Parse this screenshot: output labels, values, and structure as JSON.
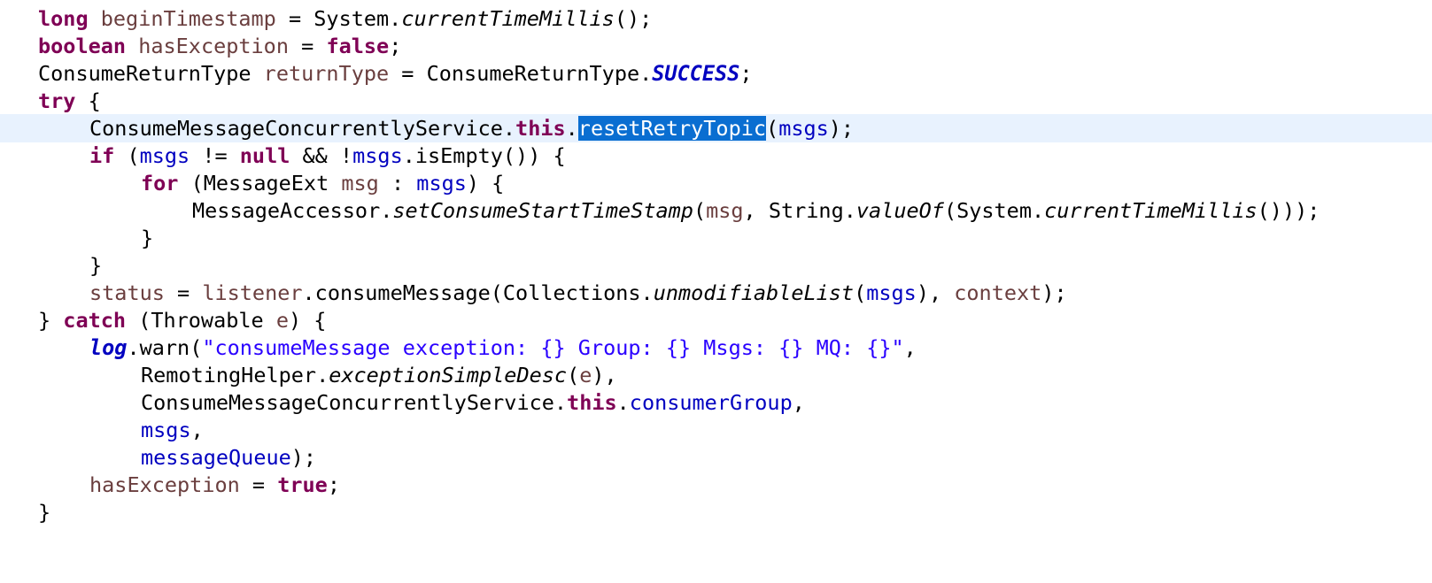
{
  "editor": {
    "selected_token": "resetRetryTopic",
    "lines": [
      [
        "long",
        " ",
        "beginTimestamp",
        " = System.",
        "currentTimeMillis",
        "();"
      ],
      [
        "boolean",
        " ",
        "hasException",
        " = ",
        "false",
        ";"
      ],
      [
        "ConsumeReturnType ",
        "returnType",
        " = ConsumeReturnType.",
        "SUCCESS",
        ";"
      ],
      [
        "try",
        " {"
      ],
      [
        "ConsumeMessageConcurrentlyService.",
        "this",
        ".",
        "resetRetryTopic",
        "(",
        "msgs",
        ");"
      ],
      [
        "if",
        " (",
        "msgs",
        " != ",
        "null",
        " && !",
        "msgs",
        ".isEmpty()) {"
      ],
      [
        "for",
        " (MessageExt ",
        "msg",
        " : ",
        "msgs",
        ") {"
      ],
      [
        "MessageAccessor.",
        "setConsumeStartTimeStamp",
        "(",
        "msg",
        ", String.",
        "valueOf",
        "(System.",
        "currentTimeMillis",
        "()));"
      ],
      [
        "}"
      ],
      [
        "}"
      ],
      [
        "status",
        " = ",
        "listener",
        ".consumeMessage(Collections.",
        "unmodifiableList",
        "(",
        "msgs",
        "), ",
        "context",
        ");"
      ],
      [
        "} ",
        "catch",
        " (Throwable ",
        "e",
        ") {"
      ],
      [
        "log",
        ".warn(",
        "\"consumeMessage exception: {} Group: {} Msgs: {} MQ: {}\"",
        ","
      ],
      [
        "RemotingHelper.",
        "exceptionSimpleDesc",
        "(",
        "e",
        "),"
      ],
      [
        "ConsumeMessageConcurrentlyService.",
        "this",
        ".",
        "consumerGroup",
        ","
      ],
      [
        "msgs",
        ","
      ],
      [
        "messageQueue",
        ");"
      ],
      [
        "hasException",
        " = ",
        "true",
        ";"
      ],
      [
        "}"
      ]
    ]
  },
  "colors": {
    "keyword": "#7f0055",
    "local_variable": "#6a3e3e",
    "field": "#0000c0",
    "string": "#2a00ff",
    "current_line": "#e8f2fe",
    "selection": "#0a6ed1"
  }
}
